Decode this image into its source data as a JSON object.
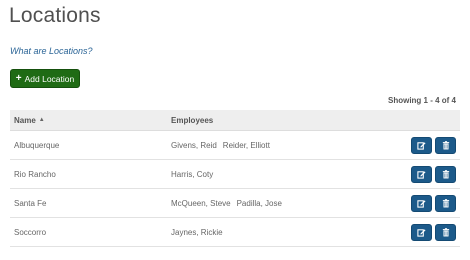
{
  "page": {
    "title": "Locations",
    "help_link": "What are Locations?",
    "add_button": "Add Location",
    "add_icon": "plus-icon",
    "showing": "Showing 1 - 4 of 4"
  },
  "table": {
    "columns": {
      "name": "Name",
      "employees": "Employees"
    },
    "sort_icon": "sort-up-icon",
    "rows": [
      {
        "name": "Albuquerque",
        "employees": [
          "Givens, Reid",
          "Reider, Elliott"
        ]
      },
      {
        "name": "Rio Rancho",
        "employees": [
          "Harris, Coty"
        ]
      },
      {
        "name": "Santa Fe",
        "employees": [
          "McQueen, Steve",
          "Padilla, Jose"
        ]
      },
      {
        "name": "Soccorro",
        "employees": [
          "Jaynes, Rickie"
        ]
      }
    ],
    "row_actions": {
      "edit_icon": "edit-icon",
      "delete_icon": "trash-icon"
    }
  },
  "colors": {
    "add_button": "#1f6b14",
    "action_button": "#1c5a8a",
    "link": "#2a6496",
    "header_bg": "#eeeeee"
  }
}
